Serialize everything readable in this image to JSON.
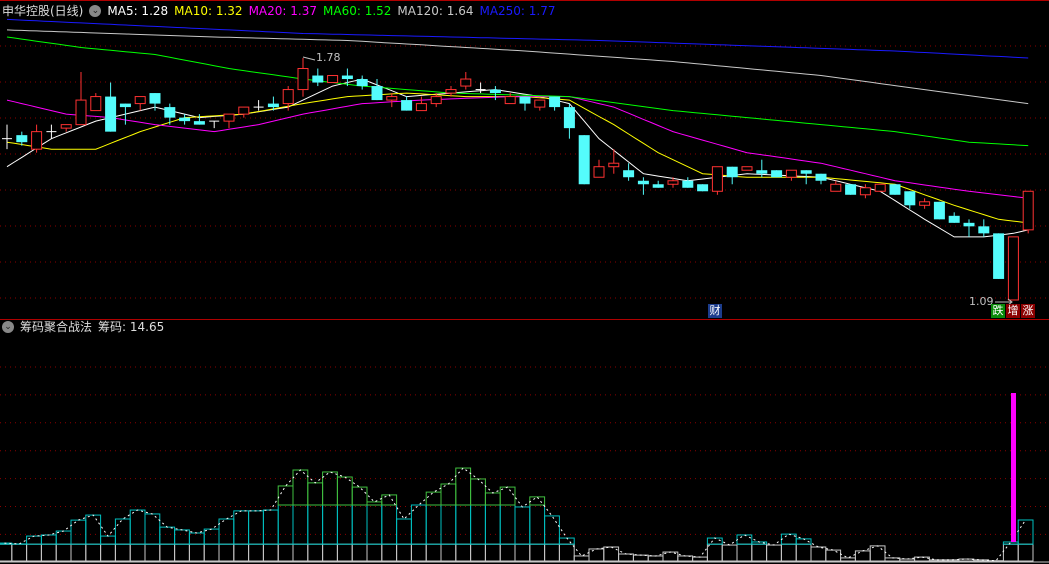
{
  "header": {
    "stock": "申华控股(日线)",
    "ma": [
      {
        "label": "MA5: 1.28",
        "color": "#ffffff"
      },
      {
        "label": "MA10: 1.32",
        "color": "#ffff00"
      },
      {
        "label": "MA20: 1.37",
        "color": "#ff00ff"
      },
      {
        "label": "MA60: 1.52",
        "color": "#00ff00"
      },
      {
        "label": "MA120: 1.64",
        "color": "#c8c8c8"
      },
      {
        "label": "MA250: 1.77",
        "color": "#1a1aff"
      }
    ]
  },
  "price_labels": {
    "high": "1.78",
    "low": "1.09"
  },
  "badges": {
    "cai": "财",
    "die": "跌",
    "zeng": "增",
    "zhang": "涨"
  },
  "indicator": {
    "title": "筹码聚合战法",
    "value_label": "筹码: 14.65"
  },
  "colors": {
    "up": "#ff3232",
    "down": "#54fcfc",
    "grid": "#8b0000",
    "white_band": "#c8c8c8",
    "cyan_band": "#00c0c0",
    "green_band": "#40c040",
    "spike": "#ff00ff"
  },
  "chart_data": {
    "type": "candlestick",
    "price_range": [
      1.09,
      1.78
    ],
    "candles": [
      [
        1.55,
        1.59,
        1.52,
        1.55
      ],
      [
        1.56,
        1.57,
        1.53,
        1.54
      ],
      [
        1.52,
        1.59,
        1.51,
        1.57
      ],
      [
        1.57,
        1.59,
        1.55,
        1.57
      ],
      [
        1.58,
        1.59,
        1.57,
        1.59
      ],
      [
        1.59,
        1.74,
        1.59,
        1.66
      ],
      [
        1.63,
        1.68,
        1.63,
        1.67
      ],
      [
        1.67,
        1.71,
        1.57,
        1.57
      ],
      [
        1.65,
        1.65,
        1.59,
        1.64
      ],
      [
        1.65,
        1.67,
        1.63,
        1.67
      ],
      [
        1.68,
        1.68,
        1.63,
        1.65
      ],
      [
        1.64,
        1.65,
        1.59,
        1.61
      ],
      [
        1.61,
        1.62,
        1.59,
        1.6
      ],
      [
        1.6,
        1.62,
        1.59,
        1.59
      ],
      [
        1.6,
        1.6,
        1.58,
        1.6
      ],
      [
        1.6,
        1.62,
        1.58,
        1.62
      ],
      [
        1.62,
        1.64,
        1.61,
        1.64
      ],
      [
        1.64,
        1.66,
        1.63,
        1.64
      ],
      [
        1.65,
        1.67,
        1.63,
        1.64
      ],
      [
        1.65,
        1.7,
        1.63,
        1.69
      ],
      [
        1.69,
        1.78,
        1.67,
        1.75
      ],
      [
        1.73,
        1.75,
        1.7,
        1.71
      ],
      [
        1.71,
        1.73,
        1.71,
        1.73
      ],
      [
        1.73,
        1.75,
        1.7,
        1.72
      ],
      [
        1.72,
        1.73,
        1.69,
        1.7
      ],
      [
        1.7,
        1.72,
        1.66,
        1.66
      ],
      [
        1.66,
        1.68,
        1.64,
        1.67
      ],
      [
        1.66,
        1.67,
        1.63,
        1.63
      ],
      [
        1.63,
        1.67,
        1.63,
        1.65
      ],
      [
        1.65,
        1.68,
        1.64,
        1.67
      ],
      [
        1.68,
        1.7,
        1.67,
        1.69
      ],
      [
        1.7,
        1.74,
        1.69,
        1.72
      ],
      [
        1.69,
        1.71,
        1.68,
        1.69
      ],
      [
        1.69,
        1.7,
        1.66,
        1.68
      ],
      [
        1.65,
        1.68,
        1.65,
        1.67
      ],
      [
        1.67,
        1.67,
        1.63,
        1.65
      ],
      [
        1.64,
        1.66,
        1.63,
        1.66
      ],
      [
        1.67,
        1.67,
        1.63,
        1.64
      ],
      [
        1.64,
        1.65,
        1.55,
        1.58
      ],
      [
        1.56,
        1.56,
        1.42,
        1.42
      ],
      [
        1.44,
        1.49,
        1.44,
        1.47
      ],
      [
        1.47,
        1.52,
        1.45,
        1.48
      ],
      [
        1.46,
        1.48,
        1.43,
        1.44
      ],
      [
        1.43,
        1.44,
        1.39,
        1.42
      ],
      [
        1.42,
        1.43,
        1.41,
        1.41
      ],
      [
        1.42,
        1.44,
        1.41,
        1.43
      ],
      [
        1.43,
        1.44,
        1.41,
        1.41
      ],
      [
        1.42,
        1.42,
        1.4,
        1.4
      ],
      [
        1.4,
        1.47,
        1.39,
        1.47
      ],
      [
        1.47,
        1.47,
        1.42,
        1.44
      ],
      [
        1.46,
        1.47,
        1.46,
        1.47
      ],
      [
        1.46,
        1.49,
        1.44,
        1.45
      ],
      [
        1.46,
        1.46,
        1.44,
        1.44
      ],
      [
        1.44,
        1.46,
        1.43,
        1.46
      ],
      [
        1.46,
        1.46,
        1.42,
        1.45
      ],
      [
        1.45,
        1.45,
        1.42,
        1.43
      ],
      [
        1.4,
        1.43,
        1.4,
        1.42
      ],
      [
        1.42,
        1.42,
        1.39,
        1.39
      ],
      [
        1.39,
        1.42,
        1.38,
        1.41
      ],
      [
        1.4,
        1.42,
        1.4,
        1.42
      ],
      [
        1.42,
        1.42,
        1.39,
        1.39
      ],
      [
        1.4,
        1.4,
        1.35,
        1.36
      ],
      [
        1.36,
        1.38,
        1.35,
        1.37
      ],
      [
        1.37,
        1.37,
        1.32,
        1.32
      ],
      [
        1.33,
        1.34,
        1.31,
        1.31
      ],
      [
        1.31,
        1.32,
        1.27,
        1.3
      ],
      [
        1.3,
        1.32,
        1.27,
        1.28
      ],
      [
        1.28,
        1.28,
        1.15,
        1.15
      ],
      [
        1.09,
        1.27,
        1.09,
        1.27
      ],
      [
        1.29,
        1.4,
        1.28,
        1.4
      ]
    ],
    "ma_lines": [
      {
        "name": "MA5",
        "color": "#ffffff",
        "points": [
          [
            0,
            1.47
          ],
          [
            3,
            1.55
          ],
          [
            6,
            1.6
          ],
          [
            10,
            1.64
          ],
          [
            13,
            1.61
          ],
          [
            16,
            1.62
          ],
          [
            19,
            1.64
          ],
          [
            22,
            1.7
          ],
          [
            24,
            1.72
          ],
          [
            27,
            1.67
          ],
          [
            30,
            1.68
          ],
          [
            33,
            1.69
          ],
          [
            36,
            1.67
          ],
          [
            38,
            1.65
          ],
          [
            40,
            1.55
          ],
          [
            43,
            1.45
          ],
          [
            46,
            1.43
          ],
          [
            50,
            1.45
          ],
          [
            55,
            1.44
          ],
          [
            59,
            1.4
          ],
          [
            62,
            1.32
          ],
          [
            64,
            1.27
          ],
          [
            66,
            1.27
          ],
          [
            68,
            1.28
          ],
          [
            69,
            1.29
          ]
        ]
      },
      {
        "name": "MA10",
        "color": "#ffff00",
        "points": [
          [
            0,
            1.54
          ],
          [
            3,
            1.52
          ],
          [
            6,
            1.52
          ],
          [
            9,
            1.57
          ],
          [
            12,
            1.61
          ],
          [
            16,
            1.62
          ],
          [
            20,
            1.65
          ],
          [
            23,
            1.67
          ],
          [
            27,
            1.68
          ],
          [
            31,
            1.67
          ],
          [
            35,
            1.67
          ],
          [
            38,
            1.66
          ],
          [
            41,
            1.59
          ],
          [
            44,
            1.51
          ],
          [
            47,
            1.45
          ],
          [
            50,
            1.44
          ],
          [
            55,
            1.44
          ],
          [
            60,
            1.42
          ],
          [
            64,
            1.36
          ],
          [
            67,
            1.32
          ],
          [
            69,
            1.31
          ]
        ]
      },
      {
        "name": "MA20",
        "color": "#ff00ff",
        "points": [
          [
            0,
            1.66
          ],
          [
            4,
            1.62
          ],
          [
            7,
            1.61
          ],
          [
            10,
            1.59
          ],
          [
            14,
            1.57
          ],
          [
            17,
            1.59
          ],
          [
            20,
            1.62
          ],
          [
            24,
            1.65
          ],
          [
            28,
            1.66
          ],
          [
            34,
            1.67
          ],
          [
            38,
            1.67
          ],
          [
            41,
            1.64
          ],
          [
            45,
            1.57
          ],
          [
            50,
            1.51
          ],
          [
            55,
            1.48
          ],
          [
            60,
            1.43
          ],
          [
            65,
            1.4
          ],
          [
            69,
            1.38
          ]
        ]
      },
      {
        "name": "MA60",
        "color": "#00ff00",
        "points": [
          [
            0,
            1.84
          ],
          [
            5,
            1.81
          ],
          [
            10,
            1.79
          ],
          [
            15,
            1.75
          ],
          [
            20,
            1.72
          ],
          [
            24,
            1.7
          ],
          [
            30,
            1.68
          ],
          [
            38,
            1.67
          ],
          [
            45,
            1.63
          ],
          [
            50,
            1.61
          ],
          [
            55,
            1.59
          ],
          [
            60,
            1.57
          ],
          [
            65,
            1.54
          ],
          [
            69,
            1.53
          ]
        ]
      },
      {
        "name": "MA120",
        "color": "#c8c8c8",
        "points": [
          [
            0,
            1.86
          ],
          [
            14,
            1.84
          ],
          [
            23,
            1.83
          ],
          [
            35,
            1.8
          ],
          [
            45,
            1.77
          ],
          [
            55,
            1.73
          ],
          [
            62,
            1.69
          ],
          [
            69,
            1.65
          ]
        ]
      },
      {
        "name": "MA250",
        "color": "#1a1aff",
        "points": [
          [
            0,
            1.89
          ],
          [
            20,
            1.85
          ],
          [
            40,
            1.83
          ],
          [
            60,
            1.8
          ],
          [
            69,
            1.78
          ]
        ]
      }
    ],
    "chips": {
      "thresholds": [
        6,
        20
      ],
      "values": [
        6.4,
        6.1,
        8.9,
        9.3,
        10.7,
        14.6,
        16.4,
        8.9,
        15.0,
        18.2,
        16.8,
        12.1,
        11.1,
        10.0,
        11.4,
        15.0,
        17.9,
        17.9,
        18.2,
        26.8,
        32.5,
        27.9,
        31.8,
        30.0,
        26.4,
        21.1,
        23.6,
        15.0,
        20.0,
        24.6,
        27.5,
        33.2,
        29.3,
        24.3,
        26.4,
        19.3,
        22.9,
        16.1,
        8.2,
        1.8,
        4.3,
        5.0,
        2.5,
        2.1,
        1.8,
        3.2,
        1.8,
        1.4,
        8.2,
        5.7,
        9.3,
        6.8,
        5.7,
        9.6,
        7.9,
        5.0,
        3.9,
        1.1,
        3.6,
        5.4,
        1.1,
        0.7,
        1.4,
        0.4,
        0.4,
        0.7,
        0.4,
        0.1,
        6.8,
        14.65
      ],
      "spike_value": 60
    }
  }
}
